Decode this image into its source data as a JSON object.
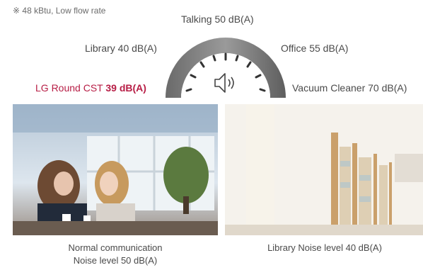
{
  "note": "※ 48 kBtu, Low flow rate",
  "gauge": {
    "talking": "Talking 50 dB(A)",
    "library": "Library 40 dB(A)",
    "office": "Office 55 dB(A)",
    "lg_prefix": "LG Round CST ",
    "lg_value": "39 dB(A)",
    "vacuum": "Vacuum Cleaner 70 dB(A)",
    "speaker_icon": "speaker-icon"
  },
  "captions": {
    "left_line1": "Normal communication",
    "left_line2": "Noise level 50 dB(A)",
    "right": "Library Noise level 40 dB(A)"
  },
  "colors": {
    "accent": "#b71d45",
    "text": "#4a4a4a",
    "arc": "#8a8a8a"
  }
}
